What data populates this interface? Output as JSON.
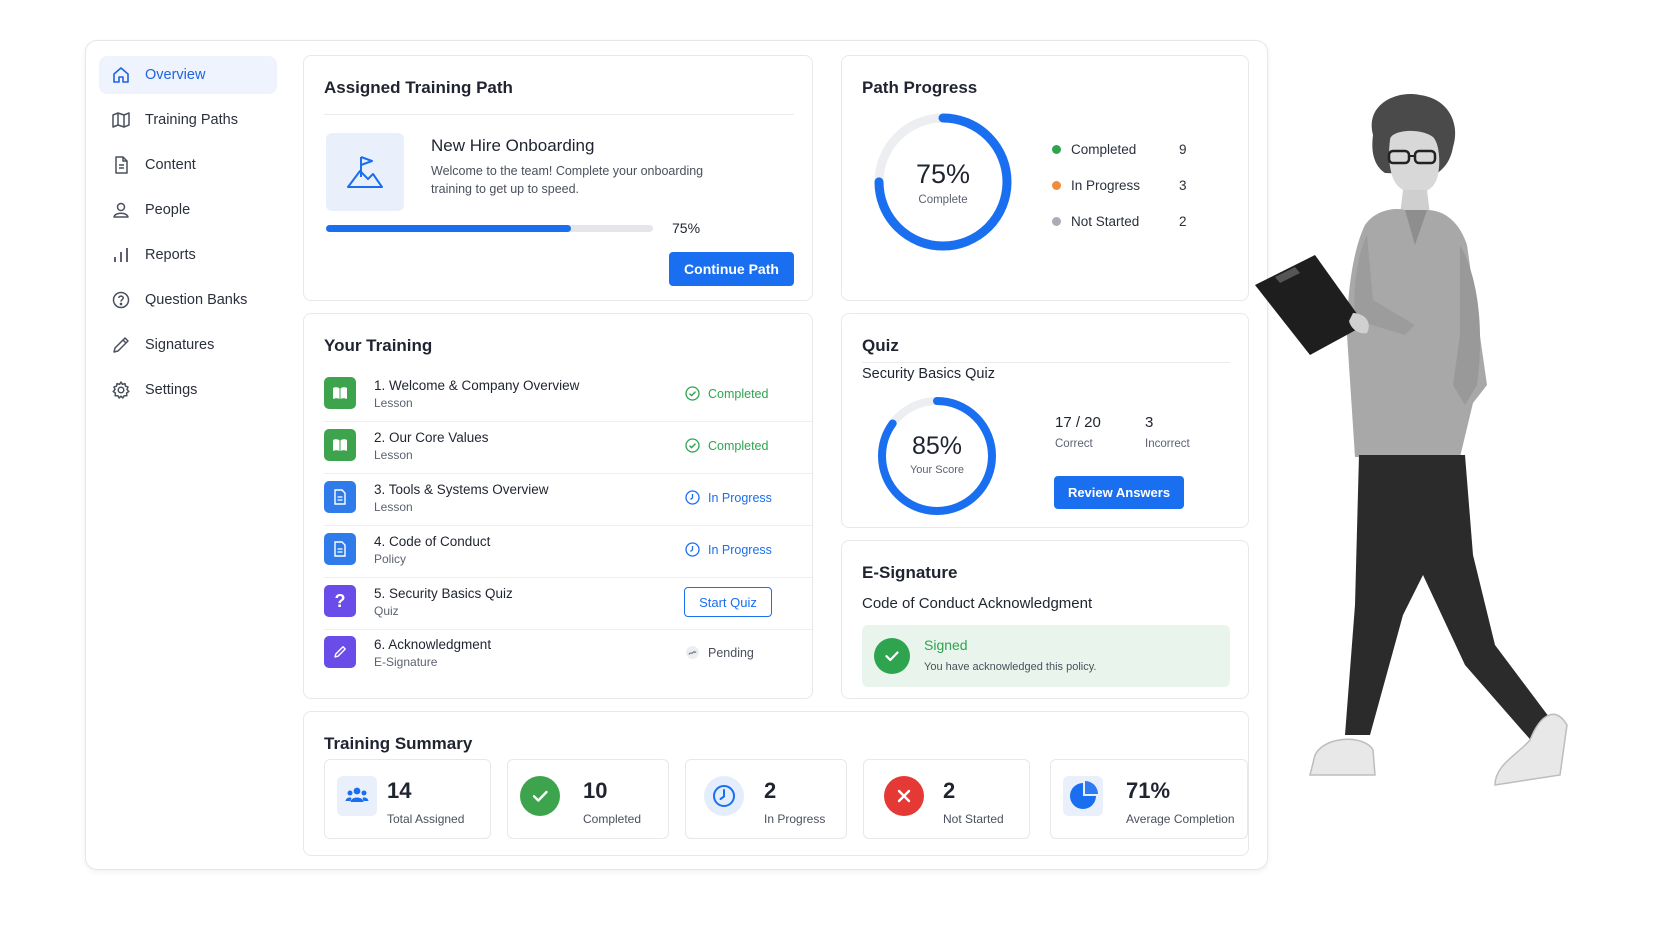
{
  "sidebar": {
    "items": [
      {
        "label": "Overview",
        "icon": "home-icon",
        "active": true
      },
      {
        "label": "Training Paths",
        "icon": "map-icon"
      },
      {
        "label": "Content",
        "icon": "document-icon"
      },
      {
        "label": "People",
        "icon": "person-icon"
      },
      {
        "label": "Reports",
        "icon": "bar-chart-icon"
      },
      {
        "label": "Question Banks",
        "icon": "question-circle-icon"
      },
      {
        "label": "Signatures",
        "icon": "pen-icon"
      },
      {
        "label": "Settings",
        "icon": "gear-icon"
      }
    ]
  },
  "assigned_path": {
    "title": "Assigned Training Path",
    "path_name": "New Hire Onboarding",
    "description_line1": "Welcome to the team! Complete your onboarding",
    "description_line2": "training to get up to speed.",
    "progress": 0.75,
    "progress_label": "75%",
    "button_label": "Continue Path",
    "icon": "flag-icon"
  },
  "path_progress": {
    "title": "Path Progress",
    "percent": 0.75,
    "percent_label": "75%",
    "percent_caption": "Complete",
    "legend": [
      {
        "label": "Completed",
        "value": "9",
        "color": "#2ea44f"
      },
      {
        "label": "In Progress",
        "value": "3",
        "color": "#f08c3a"
      },
      {
        "label": "Not Started",
        "value": "2",
        "color": "#a9adb5"
      }
    ]
  },
  "your_training": {
    "title": "Your Training",
    "items": [
      {
        "name": "1. Welcome & Company Overview",
        "type": "Lesson",
        "status": "Completed",
        "icon": "book-icon",
        "icon_color": "#3da44d"
      },
      {
        "name": "2. Our Core Values",
        "type": "Lesson",
        "status": "Completed",
        "icon": "book-icon",
        "icon_color": "#3da44d"
      },
      {
        "name": "3. Tools & Systems Overview",
        "type": "Lesson",
        "status": "In Progress",
        "icon": "document-icon",
        "icon_color": "#2f7bea"
      },
      {
        "name": "4. Code of Conduct",
        "type": "Policy",
        "status": "In Progress",
        "icon": "document-icon",
        "icon_color": "#2f7bea"
      },
      {
        "name": "5. Security Basics Quiz",
        "type": "Quiz",
        "status": "Start Quiz",
        "icon": "question-icon",
        "icon_color": "#6a4de8"
      },
      {
        "name": "6. Acknowledgment",
        "type": "E-Signature",
        "status": "Pending",
        "icon": "pen-icon",
        "icon_color": "#6a4de8"
      }
    ]
  },
  "quiz": {
    "title": "Quiz",
    "quiz_name": "Security Basics Quiz",
    "score": 0.85,
    "score_label": "85%",
    "score_caption": "Your Score",
    "correct_value": "17 / 20",
    "correct_label": "Correct",
    "incorrect_value": "3",
    "incorrect_label": "Incorrect",
    "button_label": "Review Answers"
  },
  "esignature": {
    "title": "E-Signature",
    "document": "Code of Conduct Acknowledgment",
    "status": "Signed",
    "message": "You have acknowledged this policy."
  },
  "summary": {
    "title": "Training Summary",
    "tiles": [
      {
        "value": "14",
        "label": "Total Assigned",
        "icon": "users-icon"
      },
      {
        "value": "10",
        "label": "Completed",
        "icon": "check-circle-icon"
      },
      {
        "value": "2",
        "label": "In Progress",
        "icon": "clock-icon"
      },
      {
        "value": "2",
        "label": "Not Started",
        "icon": "x-circle-icon"
      },
      {
        "value": "71%",
        "label": "Average Completion",
        "icon": "pie-chart-icon"
      }
    ]
  },
  "colors": {
    "accent": "#1a6ff0",
    "success": "#2ea44f",
    "warning": "#f08c3a",
    "danger": "#e53935",
    "purple": "#6a4de8"
  },
  "illustration": {
    "subject": "woman-with-clipboard-photo"
  }
}
